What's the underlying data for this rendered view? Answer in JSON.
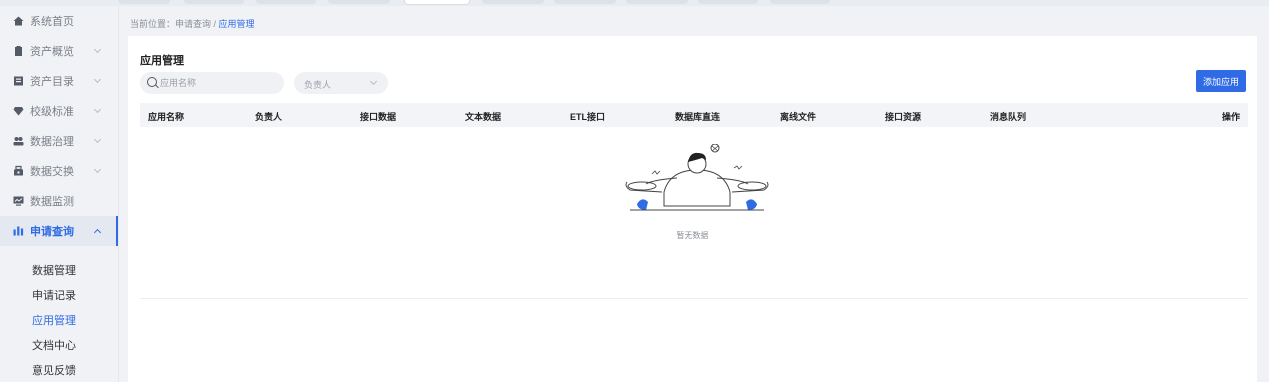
{
  "sidebar": {
    "items": [
      {
        "label": "系统首页",
        "icon": "home-icon",
        "chevron": false
      },
      {
        "label": "资产概览",
        "icon": "clipboard-icon",
        "chevron": true
      },
      {
        "label": "资产目录",
        "icon": "catalog-icon",
        "chevron": true
      },
      {
        "label": "校级标准",
        "icon": "diamond-icon",
        "chevron": true
      },
      {
        "label": "数据治理",
        "icon": "users-icon",
        "chevron": true
      },
      {
        "label": "数据交换",
        "icon": "exchange-icon",
        "chevron": true
      },
      {
        "label": "数据监测",
        "icon": "monitor-icon",
        "chevron": false
      },
      {
        "label": "申请查询",
        "icon": "bar-chart-icon",
        "chevron": true
      }
    ],
    "sub_items": [
      "数据管理",
      "申请记录",
      "应用管理",
      "文档中心",
      "意见反馈"
    ]
  },
  "breadcrumb": {
    "prefix": "当前位置：申请查询 / ",
    "current": "应用管理"
  },
  "panel": {
    "title": "应用管理",
    "search_placeholder": "应用名称",
    "owner_placeholder": "负责人",
    "add_button": "添加应用"
  },
  "table": {
    "columns": [
      "应用名称",
      "负责人",
      "接口数据",
      "文本数据",
      "ETL接口",
      "数据库直连",
      "离线文件",
      "接口资源",
      "消息队列",
      "操作"
    ]
  },
  "empty_text": "暂无数据",
  "colors": {
    "accent": "#2f6be4",
    "sidebar_bg": "#f0f2f5",
    "header_bg": "#f3f4f7"
  }
}
